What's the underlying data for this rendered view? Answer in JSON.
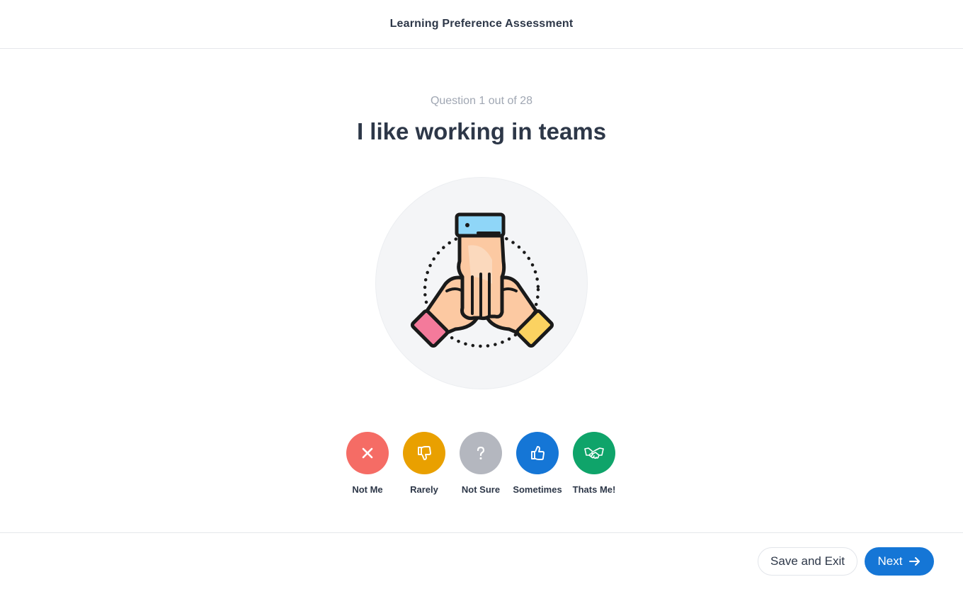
{
  "header": {
    "title": "Learning Preference Assessment"
  },
  "question": {
    "counter": "Question 1 out of 28",
    "text": "I like working in teams",
    "illustration": "team-hands-icon"
  },
  "answers": [
    {
      "label": "Not Me",
      "icon": "close-icon",
      "color": "#f56c65"
    },
    {
      "label": "Rarely",
      "icon": "thumbs-down-icon",
      "color": "#e9a000"
    },
    {
      "label": "Not Sure",
      "icon": "question-icon",
      "color": "#b4b7bf"
    },
    {
      "label": "Sometimes",
      "icon": "thumbs-up-icon",
      "color": "#1576d6"
    },
    {
      "label": "Thats Me!",
      "icon": "handshake-icon",
      "color": "#0fa46a"
    }
  ],
  "footer": {
    "save_label": "Save and Exit",
    "next_label": "Next",
    "next_icon": "arrow-right-icon"
  }
}
